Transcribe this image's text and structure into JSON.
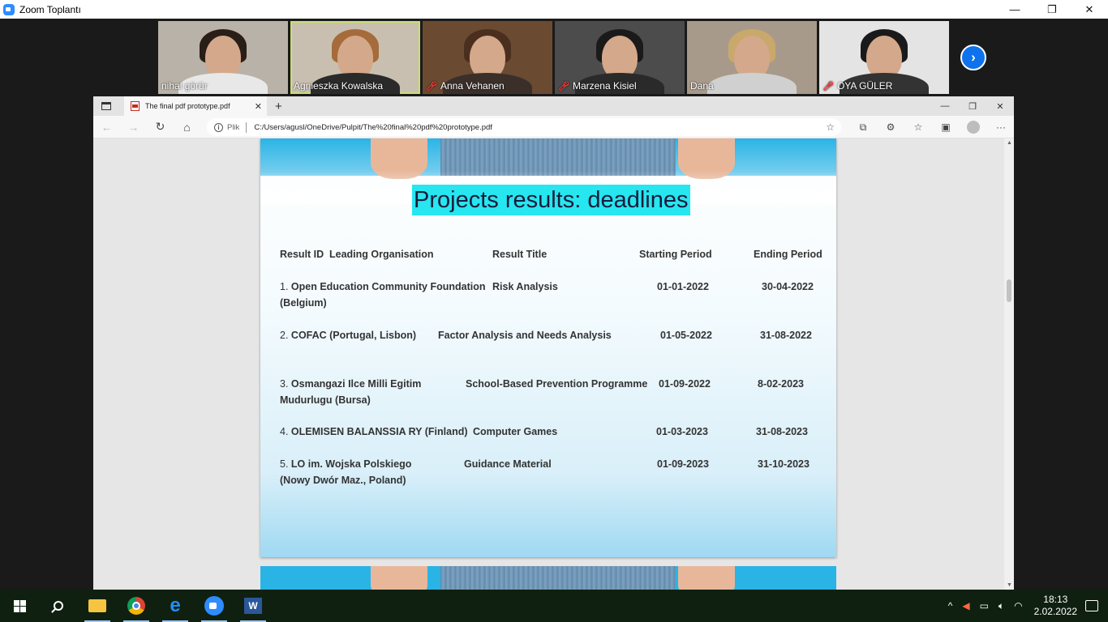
{
  "zoom": {
    "title": "Zoom Toplantı",
    "participants": [
      {
        "name": "nihal görür",
        "muted": false,
        "bg": "#b8b2a8",
        "hair": "#2a1e18",
        "body": "#e8e8e8"
      },
      {
        "name": "Agnieszka Kowalska",
        "muted": false,
        "bg": "#c9bfb0",
        "hair": "#a56b3a",
        "body": "#2a2a2a"
      },
      {
        "name": "Anna Vehanen",
        "muted": true,
        "bg": "#6b4a32",
        "hair": "#4a2f1f",
        "body": "#3b2f2a"
      },
      {
        "name": "Marzena Kisiel",
        "muted": true,
        "bg": "#4c4c4c",
        "hair": "#1a1a1a",
        "body": "#2a2a2a"
      },
      {
        "name": "Dana",
        "muted": false,
        "bg": "#a89a8a",
        "hair": "#c9a86b",
        "body": "#d0d0d0"
      },
      {
        "name": "OYA GÜLER",
        "muted": true,
        "bg": "#e4e4e4",
        "hair": "#1a1a1a",
        "body": "#333333"
      }
    ]
  },
  "browser": {
    "tab_title": "The final pdf prototype.pdf",
    "url_label": "Plik",
    "url": "C:/Users/agusl/OneDrive/Pulpit/The%20final%20pdf%20prototype.pdf"
  },
  "slide": {
    "title": "Projects results: deadlines",
    "headers": {
      "result_id": "Result ID",
      "leading_org": "Leading Organisation",
      "result_title": "Result Title",
      "starting": "Starting Period",
      "ending": "Ending Period"
    },
    "rows": [
      {
        "num": "1.",
        "org": "Open Education Community Foundation",
        "org2": "(Belgium)",
        "title": "Risk Analysis",
        "start": "01-01-2022",
        "end": "30-04-2022"
      },
      {
        "num": "2.",
        "org": "COFAC  (Portugal, Lisbon)",
        "org2": "",
        "title": "Factor Analysis  and Needs Analysis",
        "start": "01-05-2022",
        "end": "31-08-2022"
      },
      {
        "num": "3.",
        "org": "Osmangazi Ilce Milli Egitim",
        "org2": "Mudurlugu (Bursa)",
        "title": "School-Based Prevention Programme",
        "start": "01-09-2022",
        "end": "8-02-2023"
      },
      {
        "num": "4.",
        "org": "OLEMISEN BALANSSIA RY (Finland)",
        "org2": "",
        "title": "Computer Games",
        "start": "01-03-2023",
        "end": "31-08-2023"
      },
      {
        "num": "5.",
        "org": "LO  im. Wojska Polskiego",
        "org2": " (Nowy Dwór Maz., Poland)",
        "title": "Guidance Material",
        "start": "01-09-2023",
        "end": "31-10-2023"
      }
    ]
  },
  "taskbar": {
    "time": "18:13",
    "date": "2.02.2022",
    "word_letter": "W"
  }
}
